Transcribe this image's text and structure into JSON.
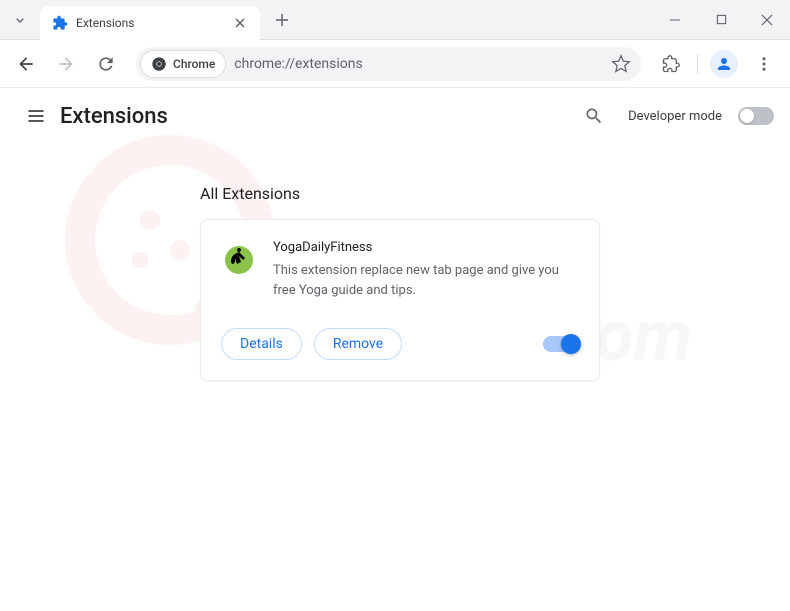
{
  "tab": {
    "title": "Extensions"
  },
  "address": {
    "chipLabel": "Chrome",
    "url": "chrome://extensions"
  },
  "header": {
    "title": "Extensions",
    "devModeLabel": "Developer mode"
  },
  "section": {
    "title": "All Extensions"
  },
  "extension": {
    "name": "YogaDailyFitness",
    "description": "This extension replace new tab page and give you free Yoga guide and tips.",
    "detailsLabel": "Details",
    "removeLabel": "Remove"
  }
}
